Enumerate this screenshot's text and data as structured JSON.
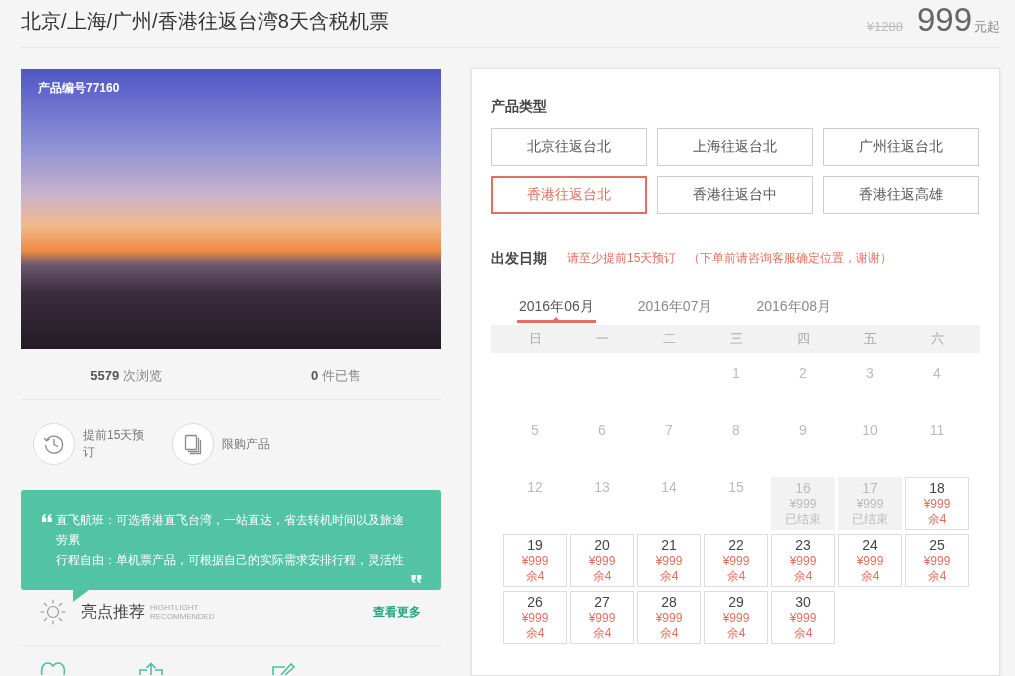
{
  "product": {
    "title": "北京/上海/广州/香港往返台湾8天含税机票",
    "old_price": "¥1288",
    "price": "999",
    "price_unit": "元起"
  },
  "gallery": {
    "caption": "产品编号77160"
  },
  "stats": [
    "**5579** 次浏览",
    "**0** 件已售"
  ],
  "features": [
    {
      "kind": "booking",
      "label": "提前15天预订"
    },
    {
      "kind": "limited",
      "label": "限购产品"
    }
  ],
  "highlights": {
    "lines": [
      "直飞航班：可选香港直飞台湾，一站直达，省去转机时间以及旅途劳累",
      "行程自由：单机票产品，可根据自己的实际需求安排行程，灵活性"
    ],
    "title": "亮点推荐",
    "subtitle": "HIGHTLIGHT RECOMMENDED",
    "more": "查看更多"
  },
  "booking": {
    "product_type_label": "产品类型",
    "product_types": [
      {
        "label": "北京往返台北",
        "selected": false
      },
      {
        "label": "上海往返台北",
        "selected": false
      },
      {
        "label": "广州往返台北",
        "selected": false
      },
      {
        "label": "香港往返台北",
        "selected": true
      },
      {
        "label": "香港往返台中",
        "selected": false
      },
      {
        "label": "香港往返高雄",
        "selected": false
      }
    ],
    "date_label": "出发日期",
    "notes": [
      "请至少提前15天预订",
      "（下单前请咨询客服确定位置，谢谢）"
    ],
    "months": [
      {
        "label": "2016年06月",
        "selected": true
      },
      {
        "label": "2016年07月",
        "selected": false
      },
      {
        "label": "2016年08月",
        "selected": false
      }
    ],
    "weekdays": [
      "日",
      "一",
      "二",
      "三",
      "四",
      "五",
      "六"
    ],
    "weeks": [
      [
        {
          "kind": "blank"
        },
        {
          "kind": "blank"
        },
        {
          "kind": "blank"
        },
        {
          "kind": "past",
          "day": "1"
        },
        {
          "kind": "past",
          "day": "2"
        },
        {
          "kind": "past",
          "day": "3"
        },
        {
          "kind": "past",
          "day": "4"
        }
      ],
      [
        {
          "kind": "past",
          "day": "5"
        },
        {
          "kind": "past",
          "day": "6"
        },
        {
          "kind": "past",
          "day": "7"
        },
        {
          "kind": "past",
          "day": "8"
        },
        {
          "kind": "past",
          "day": "9"
        },
        {
          "kind": "past",
          "day": "10"
        },
        {
          "kind": "past",
          "day": "11"
        }
      ],
      [
        {
          "kind": "past",
          "day": "12"
        },
        {
          "kind": "past",
          "day": "13"
        },
        {
          "kind": "past",
          "day": "14"
        },
        {
          "kind": "past",
          "day": "15"
        },
        {
          "kind": "ended",
          "day": "16",
          "price": "¥999",
          "status": "已结束"
        },
        {
          "kind": "ended",
          "day": "17",
          "price": "¥999",
          "status": "已结束"
        },
        {
          "kind": "open",
          "day": "18",
          "price": "¥999",
          "status": "余4"
        }
      ],
      [
        {
          "kind": "open",
          "day": "19",
          "price": "¥999",
          "status": "余4"
        },
        {
          "kind": "open",
          "day": "20",
          "price": "¥999",
          "status": "余4"
        },
        {
          "kind": "open",
          "day": "21",
          "price": "¥999",
          "status": "余4"
        },
        {
          "kind": "open",
          "day": "22",
          "price": "¥999",
          "status": "余4"
        },
        {
          "kind": "open",
          "day": "23",
          "price": "¥999",
          "status": "余4"
        },
        {
          "kind": "open",
          "day": "24",
          "price": "¥999",
          "status": "余4"
        },
        {
          "kind": "open",
          "day": "25",
          "price": "¥999",
          "status": "余4"
        }
      ],
      [
        {
          "kind": "open",
          "day": "26",
          "price": "¥999",
          "status": "余4"
        },
        {
          "kind": "open",
          "day": "27",
          "price": "¥999",
          "status": "余4"
        },
        {
          "kind": "open",
          "day": "28",
          "price": "¥999",
          "status": "余4"
        },
        {
          "kind": "open",
          "day": "29",
          "price": "¥999",
          "status": "余4"
        },
        {
          "kind": "open",
          "day": "30",
          "price": "¥999",
          "status": "余4"
        }
      ]
    ]
  }
}
